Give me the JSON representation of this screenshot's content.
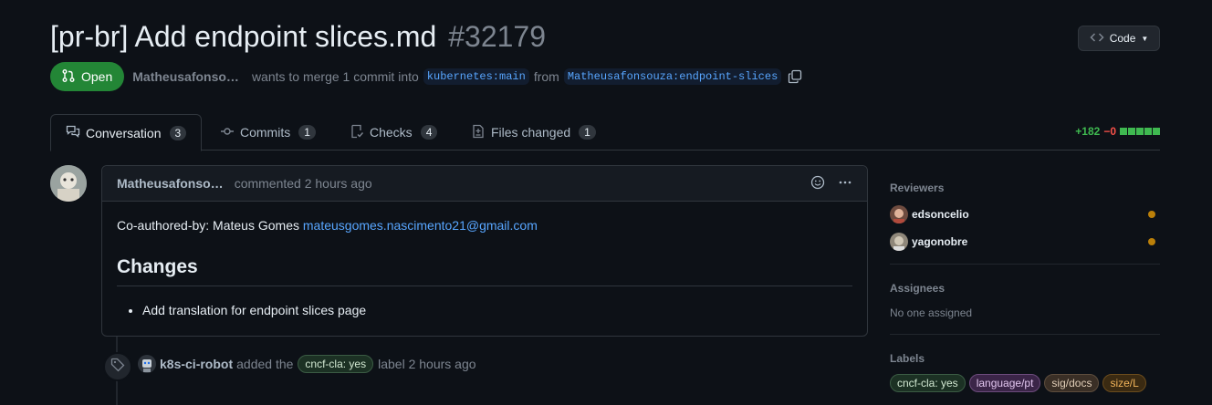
{
  "pr": {
    "title": "[pr-br] Add endpoint slices.md",
    "number": "#32179",
    "status": "Open",
    "author": "Matheusafonso…",
    "merge_text": "wants to merge 1 commit into",
    "base_branch": "kubernetes:main",
    "from_text": "from",
    "head_branch": "Matheusafonsouza:endpoint-slices"
  },
  "code_button": {
    "label": "Code"
  },
  "tabs": [
    {
      "label": "Conversation",
      "count": "3"
    },
    {
      "label": "Commits",
      "count": "1"
    },
    {
      "label": "Checks",
      "count": "4"
    },
    {
      "label": "Files changed",
      "count": "1"
    }
  ],
  "diffstat": {
    "additions": "+182",
    "deletions": "−0"
  },
  "comment": {
    "author": "Matheusafonso…",
    "action": "commented 2 hours ago",
    "coauthor_text": "Co-authored-by: Mateus Gomes ",
    "coauthor_email": "mateusgomes.nascimento21@gmail.com",
    "heading": "Changes",
    "items": [
      "Add translation for endpoint slices page"
    ]
  },
  "event": {
    "actor": "k8s-ci-robot",
    "pre": "added the",
    "label": "cncf-cla: yes",
    "post": "label 2 hours ago"
  },
  "sidebar": {
    "reviewers_title": "Reviewers",
    "reviewers": [
      "edsoncelio",
      "yagonobre"
    ],
    "assignees_title": "Assignees",
    "assignees_value": "No one assigned",
    "labels_title": "Labels",
    "labels": [
      "cncf-cla: yes",
      "language/pt",
      "sig/docs",
      "size/L"
    ]
  },
  "colors": {
    "open_green": "#238636",
    "link_blue": "#58a6ff",
    "pending_dot": "#bb8009"
  }
}
